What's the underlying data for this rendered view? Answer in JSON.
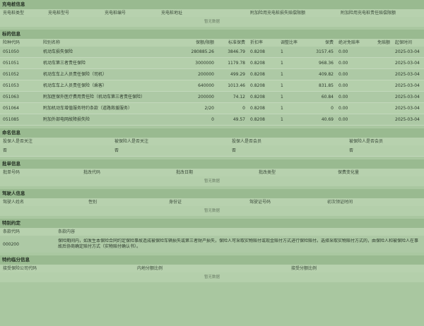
{
  "charging_pile": {
    "title": "充电桩信息",
    "headers": [
      "充电桩类型",
      "充电桩型号",
      "充电桩编号",
      "充电桩地址",
      "附加险用充电桩损失赔偿限额",
      "附加险用充电桩责任赔偿限额"
    ],
    "empty_text": "暂无数据"
  },
  "coverage": {
    "title": "标的信息",
    "headers": [
      "险种代码",
      "险别名称",
      "保额/限额",
      "标准保费",
      "折扣率",
      "调整比率",
      "保费",
      "绝对免赔率",
      "免赔额",
      "起保时间"
    ],
    "rows": [
      [
        "051050",
        "机动车损失保险",
        "280885.26",
        "3846.79",
        "0.8208",
        "1",
        "3157.45",
        "0.00",
        "",
        "2025-03-04"
      ],
      [
        "051051",
        "机动车第三者责任保险",
        "3000000",
        "1179.78",
        "0.8208",
        "1",
        "968.36",
        "0.00",
        "",
        "2025-03-04"
      ],
      [
        "051052",
        "机动车车上人员责任保险（司机）",
        "200000",
        "499.29",
        "0.8208",
        "1",
        "409.82",
        "0.00",
        "",
        "2025-03-04"
      ],
      [
        "051053",
        "机动车车上人员责任保险（乘客）",
        "640000",
        "1013.46",
        "0.8208",
        "1",
        "831.85",
        "0.00",
        "",
        "2025-03-04"
      ],
      [
        "051063",
        "附加医保外医疗费用责任险（机动车第三者责任保险）",
        "200000",
        "74.12",
        "0.8208",
        "1",
        "60.84",
        "0.00",
        "",
        "2025-03-04"
      ],
      [
        "051064",
        "附加机动车增值服务特约条款（道路救援服务）",
        "2/20",
        "0",
        "0.8208",
        "1",
        "0",
        "0.00",
        "",
        "2025-03-04"
      ],
      [
        "051085",
        "附加外部电网故障损失险",
        "0",
        "49.57",
        "0.8208",
        "1",
        "40.69",
        "0.00",
        "",
        "2025-03-04"
      ]
    ]
  },
  "ownership": {
    "title": "命名信息",
    "headers": [
      "投保人是否关注",
      "被保险人是否关注",
      "投保人是否会员",
      "被保险人是否会员"
    ],
    "values": [
      "否",
      "否",
      "否",
      "否"
    ]
  },
  "approval": {
    "title": "批单信息",
    "headers": [
      "批单号码",
      "批改代码",
      "批改日期",
      "批改类型",
      "保费变化量"
    ],
    "empty_text": "暂无数据"
  },
  "driver": {
    "title": "驾驶人信息",
    "headers": [
      "驾驶人姓名",
      "性别",
      "身份证",
      "驾驶证号码",
      "初次领证时间"
    ],
    "empty_text": "暂无数据"
  },
  "special": {
    "title": "特别约定",
    "headers": [
      "条款代码",
      "条款内容"
    ],
    "code": "000200",
    "content": "保险期间内，如发生本保险合同约定保险事故造成被保险车辆损失或第三者财产损失，保险人可采取实物赔付或现金赔付方式进行保险赔付。选择采取实物赔付方式的，由保险人和被保险人在事故后协商确定赔付方式（实物赔付确认书）。"
  },
  "coinsurance": {
    "title": "特约临分信息",
    "headers": [
      "接受保险公司代码",
      "内地分额比例",
      "接受分额比例"
    ],
    "empty_text": "暂无数据"
  }
}
